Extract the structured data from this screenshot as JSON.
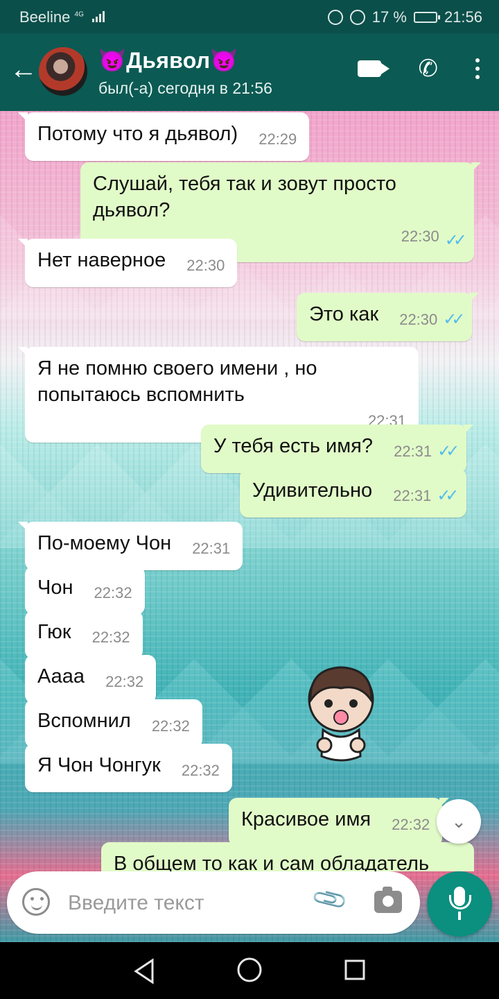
{
  "status_bar": {
    "carrier": "Beeline",
    "network": "4G",
    "battery_percent": "17 %",
    "time": "21:56"
  },
  "header": {
    "contact_name": "😈Дьявол😈",
    "last_seen": "был(-а) сегодня в 21:56",
    "icons": [
      "back-arrow-icon",
      "video-call-icon",
      "phone-icon",
      "more-options-icon"
    ]
  },
  "messages": [
    {
      "dir": "in",
      "text": "Потому что я дьявол)",
      "time": "22:29"
    },
    {
      "dir": "out",
      "text": "Слушай, тебя так и зовут просто дьявол?",
      "time": "22:30",
      "read": true
    },
    {
      "dir": "in",
      "text": "Нет наверное",
      "time": "22:30"
    },
    {
      "dir": "out",
      "text": "Это как",
      "time": "22:30",
      "read": true
    },
    {
      "dir": "in",
      "text": "Я не помню своего имени , но попытаюсь вспомнить",
      "time": "22:31"
    },
    {
      "dir": "out",
      "text": "У тебя есть имя?",
      "time": "22:31",
      "read": true
    },
    {
      "dir": "out",
      "text": "Удивительно",
      "time": "22:31",
      "read": true
    },
    {
      "dir": "in",
      "text": "По-моему Чон",
      "time": "22:31"
    },
    {
      "dir": "in",
      "text": "Чон",
      "time": "22:32"
    },
    {
      "dir": "in",
      "text": "Гюк",
      "time": "22:32"
    },
    {
      "dir": "in",
      "text": "Аааа",
      "time": "22:32"
    },
    {
      "dir": "in",
      "text": "Вспомнил",
      "time": "22:32"
    },
    {
      "dir": "in",
      "text": "Я Чон Чонгук",
      "time": "22:32"
    },
    {
      "dir": "out",
      "text": "Красивое имя",
      "time": "22:32"
    },
    {
      "dir": "out",
      "text": "В общем то как и сам обладатель",
      "time": ""
    }
  ],
  "composer": {
    "placeholder": "Введите текст",
    "icons": [
      "emoji-icon",
      "attach-icon",
      "camera-icon",
      "mic-icon"
    ]
  },
  "nav": {
    "icons": [
      "nav-back-icon",
      "nav-home-icon",
      "nav-recents-icon"
    ]
  }
}
